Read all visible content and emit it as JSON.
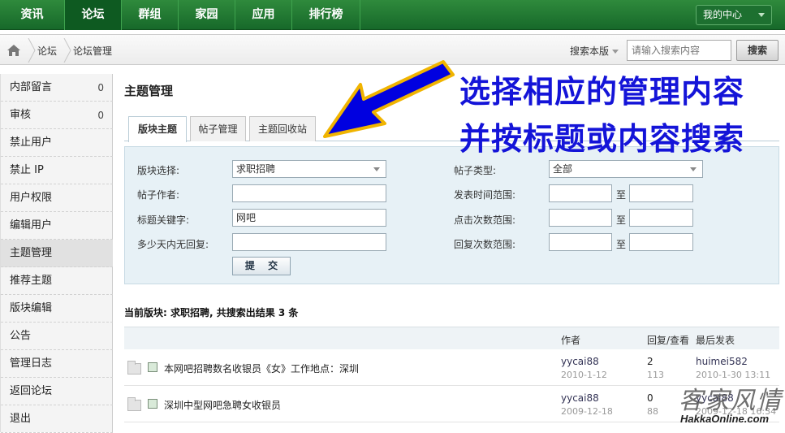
{
  "topnav": {
    "items": [
      "资讯",
      "论坛",
      "群组",
      "家园",
      "应用",
      "排行榜"
    ],
    "active_index": 1,
    "user_menu": "我的中心"
  },
  "breadcrumb": {
    "items": [
      "论坛",
      "论坛管理"
    ],
    "search_scope": "搜索本版",
    "search_placeholder": "请输入搜索内容",
    "search_button": "搜索"
  },
  "sidebar": {
    "items": [
      {
        "label": "内部留言",
        "count": "0"
      },
      {
        "label": "审核",
        "count": "0"
      },
      {
        "label": "禁止用户"
      },
      {
        "label": "禁止 IP"
      },
      {
        "label": "用户权限"
      },
      {
        "label": "编辑用户"
      },
      {
        "label": "主题管理"
      },
      {
        "label": "推荐主题"
      },
      {
        "label": "版块编辑"
      },
      {
        "label": "公告"
      },
      {
        "label": "管理日志"
      },
      {
        "label": "返回论坛"
      },
      {
        "label": "退出"
      }
    ],
    "active_index": 6
  },
  "main": {
    "title": "主题管理",
    "tabs": [
      "版块主题",
      "帖子管理",
      "主题回收站"
    ],
    "active_tab": 0,
    "form": {
      "forum_label": "版块选择:",
      "forum_value": "求职招聘",
      "author_label": "帖子作者:",
      "author_value": "",
      "keyword_label": "标题关键字:",
      "keyword_value": "网吧",
      "noreply_label": "多少天内无回复:",
      "noreply_value": "",
      "type_label": "帖子类型:",
      "type_value": "全部",
      "time_label": "发表时间范围:",
      "clicks_label": "点击次数范围:",
      "replies_label": "回复次数范围:",
      "to": "至",
      "submit": "提 交"
    },
    "result_text": "当前版块: 求职招聘, 共搜索出结果 3 条",
    "list": {
      "headers": {
        "author": "作者",
        "stats": "回复/查看",
        "last": "最后发表"
      },
      "rows": [
        {
          "title": "本网吧招聘数名收银员《女》工作地点：深圳",
          "author": "yycai88",
          "date": "2010-1-12",
          "replies": "2",
          "views": "113",
          "last_user": "huimei582",
          "last_date": "2010-1-30 13:11"
        },
        {
          "title": "深圳中型网吧急聘女收银员",
          "author": "yycai88",
          "date": "2009-12-18",
          "replies": "0",
          "views": "88",
          "last_user": "yycai88",
          "last_date": "2009-12-18 16:34"
        }
      ]
    }
  },
  "annotation": {
    "line1": "选择相应的管理内容",
    "line2": "并按标题或内容搜索",
    "color": "#1414d8",
    "arrow_color": "#0000e0",
    "arrow_outline": "#f0b400"
  },
  "watermark": {
    "script": "客家风情",
    "url": "HakkaOnline.com"
  }
}
